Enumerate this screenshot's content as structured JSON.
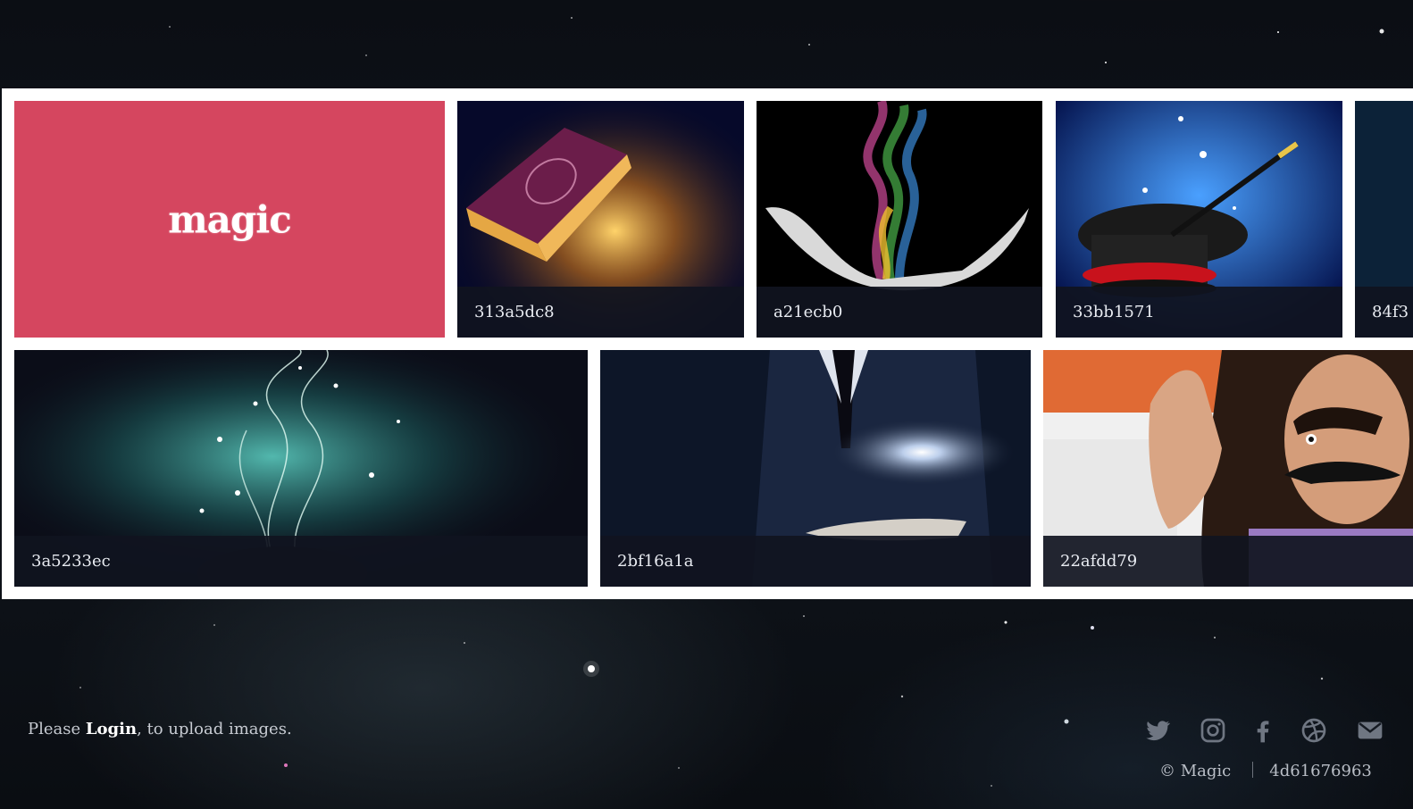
{
  "gallery": {
    "feature_logo": "magic",
    "tiles": [
      {
        "caption": "313a5dc8"
      },
      {
        "caption": "a21ecb0"
      },
      {
        "caption": "33bb1571"
      },
      {
        "caption": "84f3"
      },
      {
        "caption": "3a5233ec"
      },
      {
        "caption": "2bf16a1a"
      },
      {
        "caption": "22afdd79"
      }
    ]
  },
  "footer": {
    "prefix": "Please ",
    "login_link": "Login",
    "suffix": ", to upload images.",
    "copyright": "© Magic",
    "build_id": "4d61676963",
    "social_icons": [
      "twitter-icon",
      "instagram-icon",
      "facebook-icon",
      "dribbble-icon",
      "email-icon"
    ]
  },
  "colors": {
    "feature_tile": "#d5465f",
    "caption_bar": "#101420",
    "frame": "#ffffff"
  }
}
